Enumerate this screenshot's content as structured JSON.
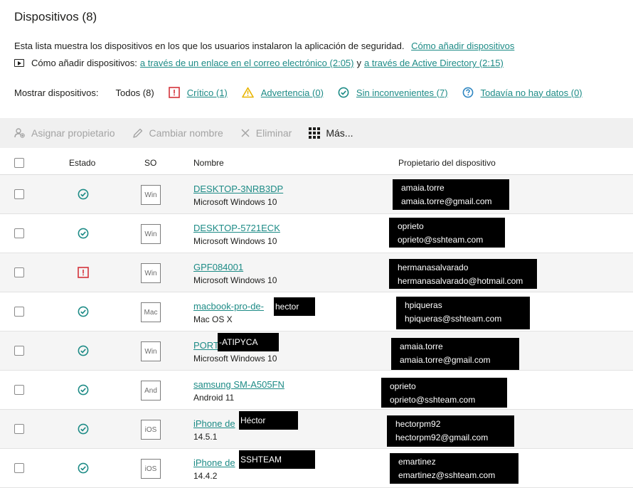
{
  "page": {
    "title": "Dispositivos (8)",
    "description": "Esta lista muestra los dispositivos en los que los usuarios instalaron la aplicación de seguridad.",
    "description_link": "Cómo añadir dispositivos",
    "video_prefix": "Cómo añadir dispositivos:",
    "video_link1": "a través de un enlace en el correo electrónico (2:05)",
    "video_middle": "y",
    "video_link2": "a través de Active Directory (2:15)"
  },
  "filters": {
    "label": "Mostrar dispositivos:",
    "all": "Todos (8)",
    "critical": "Crítico (1)",
    "warning": "Advertencia (0)",
    "ok": "Sin inconvenientes (7)",
    "nodata": "Todavía no hay datos (0)"
  },
  "toolbar": {
    "assign": "Asignar propietario",
    "rename": "Cambiar nombre",
    "delete": "Eliminar",
    "more": "Más..."
  },
  "columns": {
    "status": "Estado",
    "os": "SO",
    "name": "Nombre",
    "owner": "Propietario del dispositivo"
  },
  "colors": {
    "link": "#1d8b86",
    "ok": "#1d8b86",
    "critical": "#d4323a",
    "warning": "#e8b400",
    "nodata": "#2e86c1"
  },
  "devices": [
    {
      "status": "ok",
      "os": "Win",
      "name": "DESKTOP-3NRB3DP",
      "system": "Microsoft Windows 10",
      "owner_user": "amaia.torre",
      "owner_email": "amaia.torre@gmail.com",
      "name_mask": ""
    },
    {
      "status": "ok",
      "os": "Win",
      "name": "DESKTOP-5721ECK",
      "system": "Microsoft Windows 10",
      "owner_user": "oprieto",
      "owner_email": "oprieto@sshteam.com",
      "name_mask": ""
    },
    {
      "status": "critical",
      "os": "Win",
      "name": "GPF084001",
      "system": "Microsoft Windows 10",
      "owner_user": "hermanasalvarado",
      "owner_email": "hermanasalvarado@hotmail.com",
      "name_mask": ""
    },
    {
      "status": "ok",
      "os": "Mac",
      "name": "macbook-pro-de-",
      "system": "Mac OS X",
      "owner_user": "hpiqueras",
      "owner_email": "hpiqueras@sshteam.com",
      "name_mask": "hector"
    },
    {
      "status": "ok",
      "os": "Win",
      "name": "PORT",
      "system": "Microsoft Windows 10",
      "owner_user": "amaia.torre",
      "owner_email": "amaia.torre@gmail.com",
      "name_mask": "-ATIPYCA"
    },
    {
      "status": "ok",
      "os": "And",
      "name": "samsung SM-A505FN",
      "system": "Android 11",
      "owner_user": "oprieto",
      "owner_email": "oprieto@sshteam.com",
      "name_mask": ""
    },
    {
      "status": "ok",
      "os": "iOS",
      "name": "iPhone de",
      "system": "14.5.1",
      "owner_user": "hectorpm92",
      "owner_email": "hectorpm92@gmail.com",
      "name_mask": "Héctor"
    },
    {
      "status": "ok",
      "os": "iOS",
      "name": "iPhone de",
      "system": "14.4.2",
      "owner_user": "emartinez",
      "owner_email": "emartinez@sshteam.com",
      "name_mask": "SSHTEAM"
    }
  ]
}
